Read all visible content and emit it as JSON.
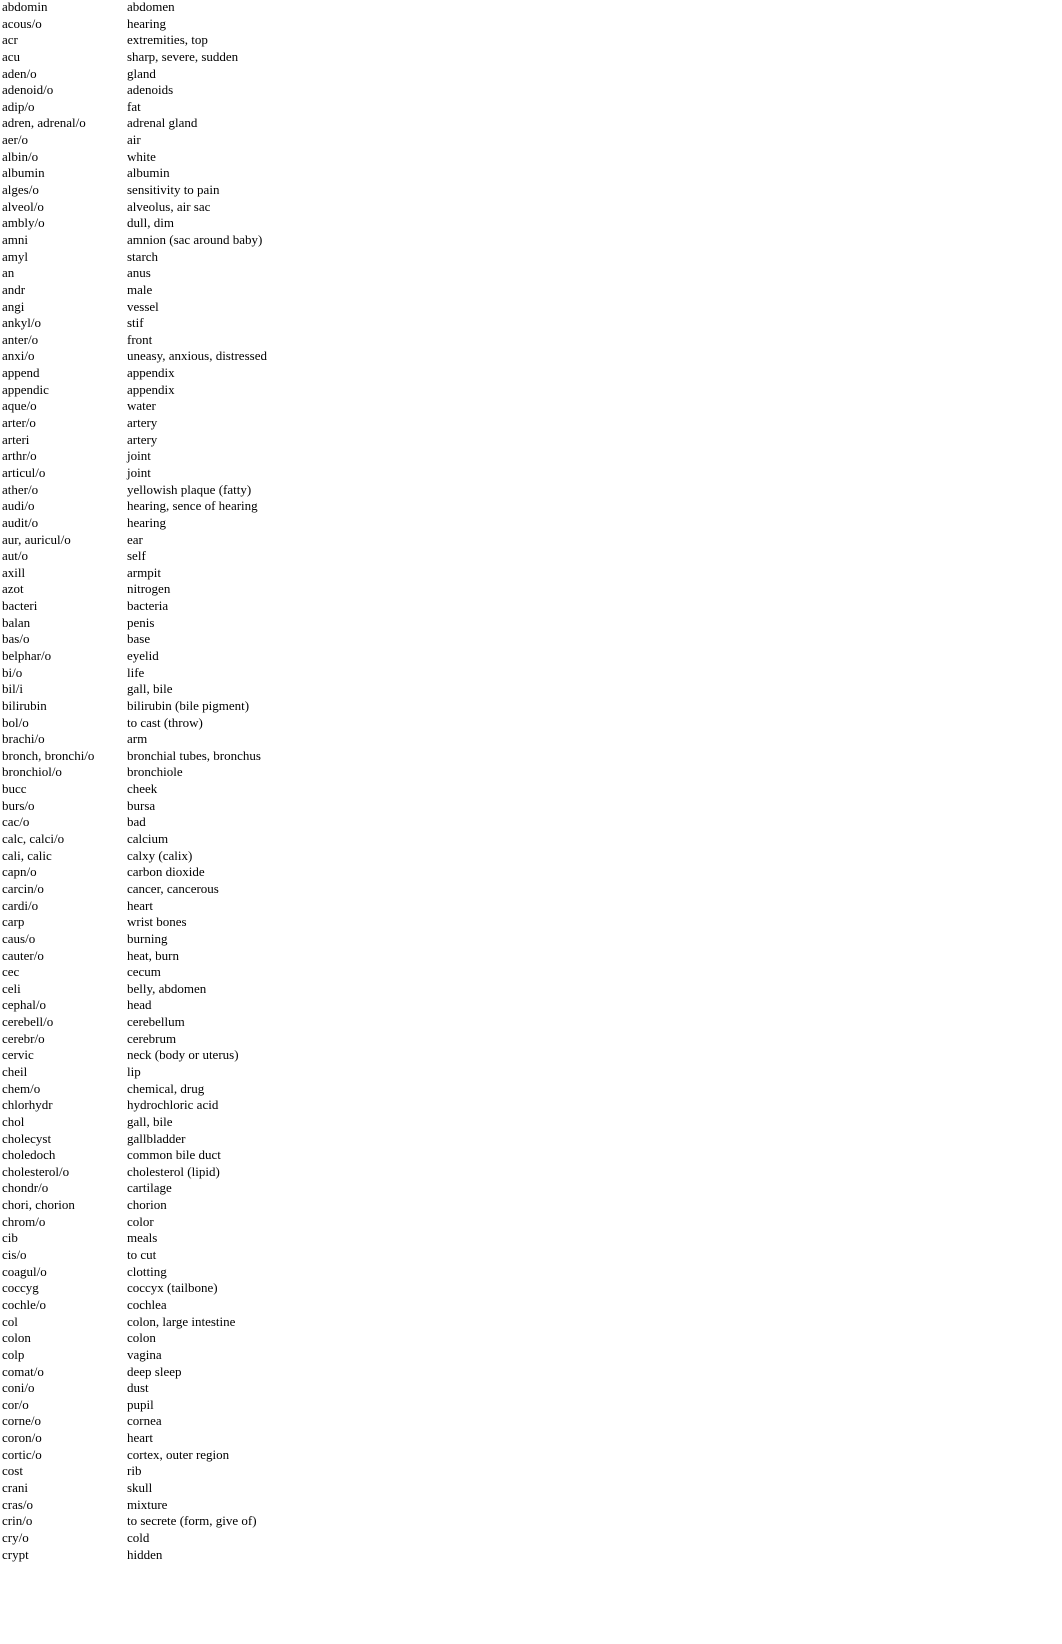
{
  "rows": [
    [
      "abdomin",
      "abdomen"
    ],
    [
      "acous/o",
      "hearing"
    ],
    [
      "acr",
      "extremities, top"
    ],
    [
      "acu",
      "sharp, severe, sudden"
    ],
    [
      "aden/o",
      "gland"
    ],
    [
      "adenoid/o",
      "adenoids"
    ],
    [
      "adip/o",
      "fat"
    ],
    [
      "adren, adrenal/o",
      "adrenal gland"
    ],
    [
      "aer/o",
      "air"
    ],
    [
      "albin/o",
      "white"
    ],
    [
      "albumin",
      "albumin"
    ],
    [
      "alges/o",
      "sensitivity to pain"
    ],
    [
      "alveol/o",
      "alveolus, air sac"
    ],
    [
      "ambly/o",
      "dull, dim"
    ],
    [
      "amni",
      "amnion (sac around baby)"
    ],
    [
      "amyl",
      "starch"
    ],
    [
      "an",
      "anus"
    ],
    [
      "andr",
      "male"
    ],
    [
      "angi",
      "vessel"
    ],
    [
      "ankyl/o",
      "stif"
    ],
    [
      "anter/o",
      "front"
    ],
    [
      "anxi/o",
      "uneasy, anxious, distressed"
    ],
    [
      "append",
      "appendix"
    ],
    [
      "appendic",
      "appendix"
    ],
    [
      "aque/o",
      "water"
    ],
    [
      "arter/o",
      "artery"
    ],
    [
      "arteri",
      "artery"
    ],
    [
      "arthr/o",
      "joint"
    ],
    [
      "articul/o",
      "joint"
    ],
    [
      "ather/o",
      "yellowish plaque (fatty)"
    ],
    [
      "audi/o",
      "hearing, sence of hearing"
    ],
    [
      "audit/o",
      "hearing"
    ],
    [
      "aur, auricul/o",
      "ear"
    ],
    [
      "aut/o",
      "self"
    ],
    [
      "axill",
      "armpit"
    ],
    [
      "azot",
      "nitrogen"
    ],
    [
      "bacteri",
      "bacteria"
    ],
    [
      "balan",
      "penis"
    ],
    [
      "bas/o",
      "base"
    ],
    [
      "belphar/o",
      "eyelid"
    ],
    [
      "bi/o",
      "life"
    ],
    [
      "bil/i",
      "gall, bile"
    ],
    [
      "bilirubin",
      "bilirubin (bile pigment)"
    ],
    [
      "bol/o",
      "to cast (throw)"
    ],
    [
      "brachi/o",
      "arm"
    ],
    [
      "bronch, bronchi/o",
      "bronchial tubes, bronchus"
    ],
    [
      "bronchiol/o",
      "bronchiole"
    ],
    [
      "bucc",
      "cheek"
    ],
    [
      "burs/o",
      "bursa"
    ],
    [
      "cac/o",
      "bad"
    ],
    [
      "calc, calci/o",
      "calcium"
    ],
    [
      "cali, calic",
      "calxy (calix)"
    ],
    [
      "capn/o",
      "carbon dioxide"
    ],
    [
      "carcin/o",
      "cancer, cancerous"
    ],
    [
      "cardi/o",
      "heart"
    ],
    [
      "carp",
      "wrist bones"
    ],
    [
      "caus/o",
      "burning"
    ],
    [
      "cauter/o",
      "heat, burn"
    ],
    [
      "cec",
      "cecum"
    ],
    [
      "celi",
      "belly, abdomen"
    ],
    [
      "cephal/o",
      "head"
    ],
    [
      "cerebell/o",
      "cerebellum"
    ],
    [
      "cerebr/o",
      "cerebrum"
    ],
    [
      "cervic",
      "neck (body or uterus)"
    ],
    [
      "cheil",
      "lip"
    ],
    [
      "chem/o",
      "chemical, drug"
    ],
    [
      "chlorhydr",
      "hydrochloric acid"
    ],
    [
      "chol",
      "gall, bile"
    ],
    [
      "cholecyst",
      "gallbladder"
    ],
    [
      "choledoch",
      "common bile duct"
    ],
    [
      "cholesterol/o",
      "cholesterol (lipid)"
    ],
    [
      "chondr/o",
      "cartilage"
    ],
    [
      "chori, chorion",
      "chorion"
    ],
    [
      "chrom/o",
      "color"
    ],
    [
      "cib",
      "meals"
    ],
    [
      "cis/o",
      "to cut"
    ],
    [
      "coagul/o",
      "clotting"
    ],
    [
      "coccyg",
      "coccyx (tailbone)"
    ],
    [
      "cochle/o",
      "cochlea"
    ],
    [
      "col",
      "colon, large intestine"
    ],
    [
      "colon",
      "colon"
    ],
    [
      "colp",
      "vagina"
    ],
    [
      "comat/o",
      "deep sleep"
    ],
    [
      "coni/o",
      "dust"
    ],
    [
      "cor/o",
      "pupil"
    ],
    [
      "corne/o",
      "cornea"
    ],
    [
      "coron/o",
      "heart"
    ],
    [
      "cortic/o",
      "cortex, outer region"
    ],
    [
      "cost",
      "rib"
    ],
    [
      "crani",
      "skull"
    ],
    [
      "cras/o",
      "mixture"
    ],
    [
      "crin/o",
      "to secrete (form, give of)"
    ],
    [
      "cry/o",
      "cold"
    ],
    [
      "crypt",
      "hidden"
    ]
  ]
}
